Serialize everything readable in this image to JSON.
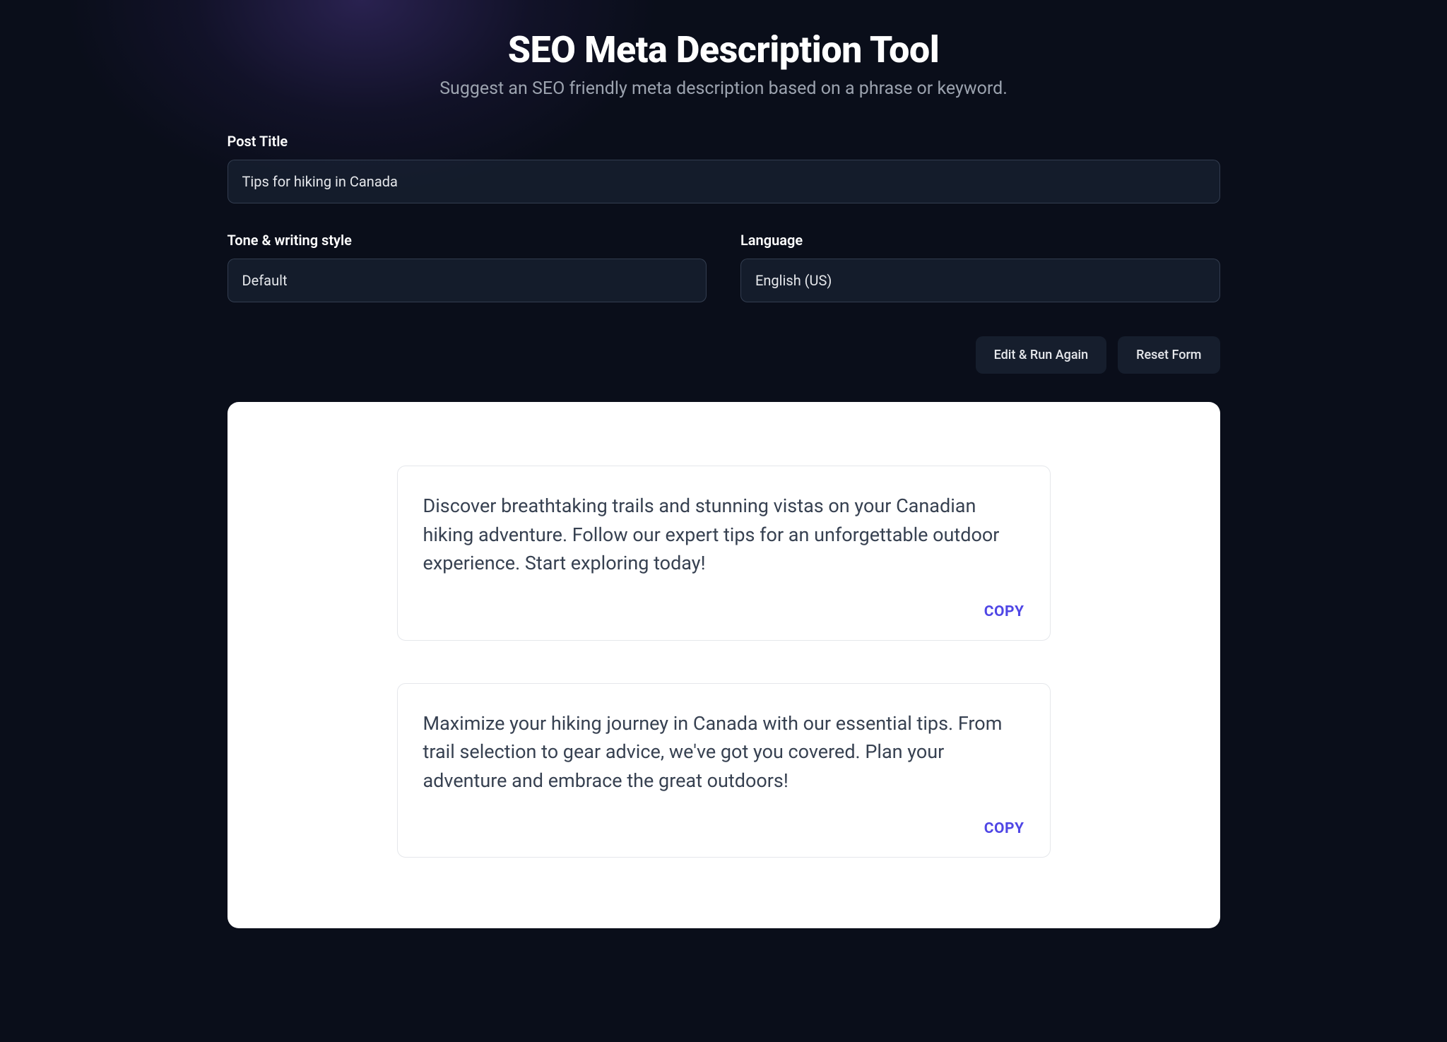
{
  "header": {
    "title": "SEO Meta Description Tool",
    "subtitle": "Suggest an SEO friendly meta description based on a phrase or keyword."
  },
  "form": {
    "postTitle": {
      "label": "Post Title",
      "value": "Tips for hiking in Canada"
    },
    "tone": {
      "label": "Tone & writing style",
      "value": "Default"
    },
    "language": {
      "label": "Language",
      "value": "English (US)"
    }
  },
  "actions": {
    "editRun": "Edit & Run Again",
    "reset": "Reset Form"
  },
  "results": [
    {
      "text": "Discover breathtaking trails and stunning vistas on your Canadian hiking adventure. Follow our expert tips for an unforgettable outdoor experience. Start exploring today!",
      "copyLabel": "COPY"
    },
    {
      "text": "Maximize your hiking journey in Canada with our essential tips. From trail selection to gear advice, we've got you covered. Plan your adventure and embrace the great outdoors!",
      "copyLabel": "COPY"
    }
  ]
}
